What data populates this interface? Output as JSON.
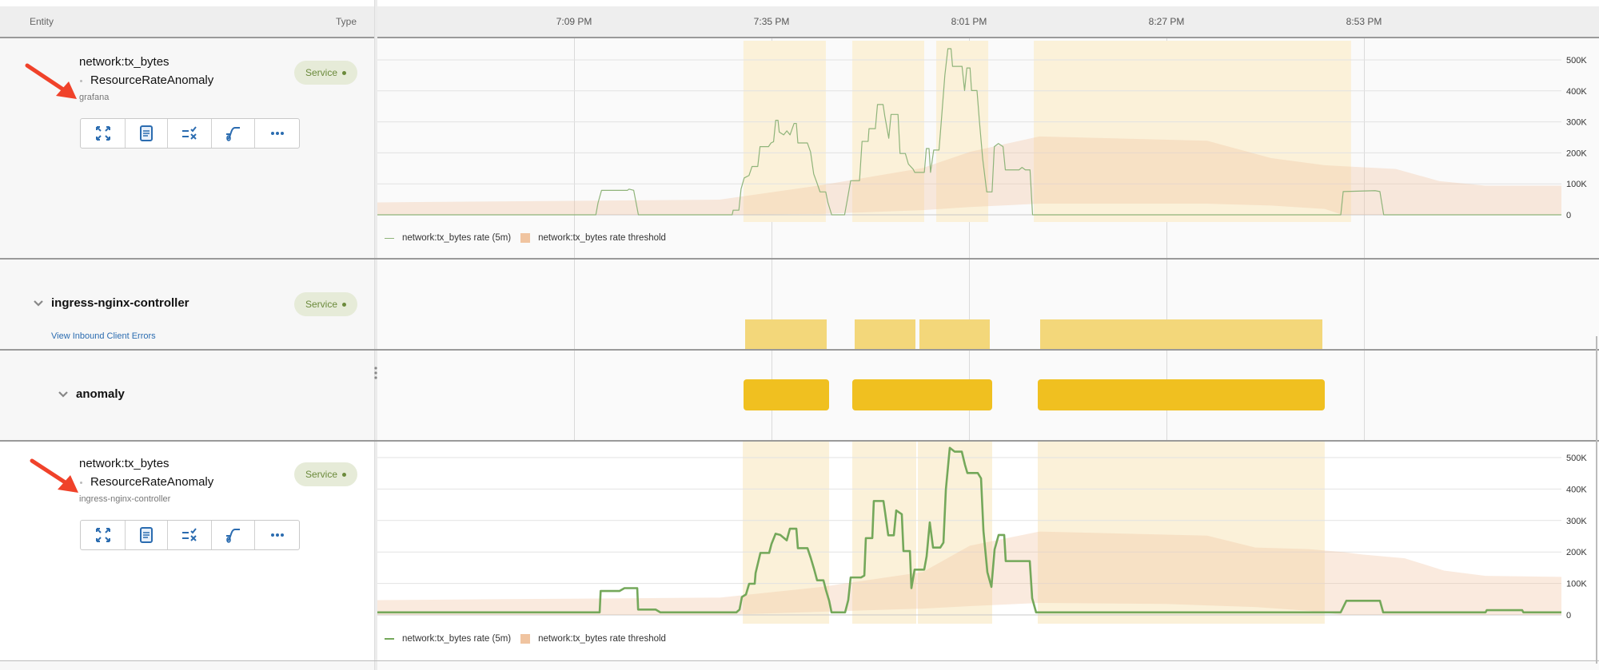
{
  "header": {
    "entity_label": "Entity",
    "type_label": "Type"
  },
  "time_axis": {
    "range": [
      "18:43:06",
      "21:19:00"
    ],
    "ticks": [
      {
        "time": "19:09:00",
        "label": "7:09 PM"
      },
      {
        "time": "19:35:00",
        "label": "7:35 PM"
      },
      {
        "time": "20:01:00",
        "label": "8:01 PM"
      },
      {
        "time": "20:27:00",
        "label": "8:27 PM"
      },
      {
        "time": "20:53:00",
        "label": "8:53 PM"
      }
    ]
  },
  "rows": [
    {
      "metric": "network:tx_bytes",
      "check": "ResourceRateAnomaly",
      "source": "grafana",
      "type_badge": "Service"
    },
    {
      "group": "ingress-nginx-controller",
      "link": "View Inbound Client Errors",
      "type_badge": "Service"
    },
    {
      "group": "anomaly"
    },
    {
      "metric": "network:tx_bytes",
      "check": "ResourceRateAnomaly",
      "source": "ingress-nginx-controller",
      "type_badge": "Service"
    }
  ],
  "action_icons": [
    "expand-icon",
    "document-icon",
    "list-check-icon",
    "curve-icon",
    "more-icon"
  ],
  "colors": {
    "series": "#74a85a",
    "threshold": "#f0c4a0",
    "anomaly_band": "#fbf1d9",
    "ingress_bar": "#f3d77a",
    "anomaly_bar": "#f0c020",
    "badge_text": "#6b8a3b",
    "link": "#2b6cb0",
    "annotation_arrow": "#f0422a"
  },
  "ingress_bars": [
    [
      "19:31:32",
      "19:42:16"
    ],
    [
      "19:45:57",
      "19:53:57"
    ],
    [
      "19:54:28",
      "20:03:44"
    ],
    [
      "20:10:22",
      "20:47:32"
    ]
  ],
  "anomaly_bars": [
    [
      "19:31:19",
      "19:42:35"
    ],
    [
      "19:45:38",
      "20:04:03"
    ],
    [
      "20:10:03",
      "20:47:50"
    ]
  ],
  "chart_data": [
    {
      "type": "line",
      "title": "",
      "ylim": [
        0,
        500000
      ],
      "yticks": [
        "0",
        "100K",
        "200K",
        "300K",
        "400K",
        "500K"
      ],
      "grid": true,
      "legend": "bottom-left",
      "legend_entries": [
        "network:tx_bytes rate (5m)",
        "network:tx_bytes rate threshold"
      ],
      "anomaly_bands": [
        [
          "19:31:18",
          "19:42:09"
        ],
        [
          "19:45:38",
          "19:55:06"
        ],
        [
          "19:56:41",
          "20:03:32"
        ],
        [
          "20:09:32",
          "20:51:18"
        ]
      ],
      "threshold": [
        [
          "18:43:06",
          0,
          40000
        ],
        [
          "19:28:10",
          0,
          49000
        ],
        [
          "19:41:38",
          3000,
          96000
        ],
        [
          "19:54:54",
          15000,
          151000
        ],
        [
          "20:01:06",
          25000,
          203000
        ],
        [
          "20:10:16",
          36000,
          253000
        ],
        [
          "20:32:22",
          36000,
          239000
        ],
        [
          "20:40:47",
          30000,
          183000
        ],
        [
          "20:47:50",
          19000,
          160000
        ],
        [
          "20:50:10",
          0,
          157000
        ],
        [
          "20:57:12",
          0,
          148000
        ],
        [
          "21:02:54",
          0,
          109000
        ],
        [
          "21:09:00",
          0,
          94000
        ],
        [
          "21:19:00",
          0,
          94000
        ]
      ],
      "series": [
        {
          "name": "network:tx_bytes rate (5m)",
          "points": [
            [
              "18:43:06",
              0
            ],
            [
              "19:11:52",
              0
            ],
            [
              "19:12:09",
              38000
            ],
            [
              "19:12:37",
              79000
            ],
            [
              "19:16:01",
              79000
            ],
            [
              "19:16:14",
              83000
            ],
            [
              "19:16:51",
              79000
            ],
            [
              "19:17:08",
              43000
            ],
            [
              "19:17:28",
              0
            ],
            [
              "19:29:49",
              0
            ],
            [
              "19:29:57",
              15000
            ],
            [
              "19:30:42",
              15000
            ],
            [
              "19:30:59",
              83000
            ],
            [
              "19:31:24",
              119000
            ],
            [
              "19:32:02",
              127000
            ],
            [
              "19:32:26",
              156000
            ],
            [
              "19:33:11",
              156000
            ],
            [
              "19:33:29",
              220000
            ],
            [
              "19:34:36",
              220000
            ],
            [
              "19:34:56",
              232000
            ],
            [
              "19:35:16",
              236000
            ],
            [
              "19:35:33",
              305000
            ],
            [
              "19:35:51",
              305000
            ],
            [
              "19:36:01",
              267000
            ],
            [
              "19:36:36",
              258000
            ],
            [
              "19:37:01",
              271000
            ],
            [
              "19:37:26",
              258000
            ],
            [
              "19:37:58",
              295000
            ],
            [
              "19:38:16",
              295000
            ],
            [
              "19:38:28",
              232000
            ],
            [
              "19:39:43",
              232000
            ],
            [
              "19:40:08",
              203000
            ],
            [
              "19:40:33",
              132000
            ],
            [
              "19:40:58",
              104000
            ],
            [
              "19:41:23",
              74000
            ],
            [
              "19:42:08",
              74000
            ],
            [
              "19:42:25",
              40000
            ],
            [
              "19:42:55",
              0
            ],
            [
              "19:44:37",
              0
            ],
            [
              "19:44:55",
              40000
            ],
            [
              "19:45:25",
              110000
            ],
            [
              "19:46:35",
              110000
            ],
            [
              "19:46:55",
              237000
            ],
            [
              "19:47:43",
              237000
            ],
            [
              "19:47:50",
              278000
            ],
            [
              "19:48:40",
              278000
            ],
            [
              "19:48:57",
              356000
            ],
            [
              "19:49:41",
              356000
            ],
            [
              "19:49:55",
              318000
            ],
            [
              "19:50:26",
              247000
            ],
            [
              "19:50:44",
              324000
            ],
            [
              "19:51:39",
              324000
            ],
            [
              "19:51:55",
              198000
            ],
            [
              "19:52:37",
              198000
            ],
            [
              "19:53:01",
              164000
            ],
            [
              "19:53:39",
              147000
            ],
            [
              "19:53:51",
              137000
            ],
            [
              "19:55:07",
              137000
            ],
            [
              "19:55:23",
              214000
            ],
            [
              "19:55:44",
              214000
            ],
            [
              "19:55:56",
              137000
            ],
            [
              "19:56:21",
              209000
            ],
            [
              "19:57:03",
              209000
            ],
            [
              "19:57:23",
              312000
            ],
            [
              "19:57:49",
              450000
            ],
            [
              "19:58:13",
              536000
            ],
            [
              "19:58:38",
              536000
            ],
            [
              "19:58:50",
              479000
            ],
            [
              "20:00:05",
              479000
            ],
            [
              "20:00:25",
              401000
            ],
            [
              "20:00:43",
              474000
            ],
            [
              "20:01:08",
              474000
            ],
            [
              "20:01:20",
              401000
            ],
            [
              "20:02:03",
              401000
            ],
            [
              "20:02:23",
              298000
            ],
            [
              "20:02:48",
              181000
            ],
            [
              "20:03:20",
              74000
            ],
            [
              "20:04:02",
              74000
            ],
            [
              "20:04:20",
              220000
            ],
            [
              "20:04:52",
              230000
            ],
            [
              "20:05:29",
              220000
            ],
            [
              "20:05:47",
              145000
            ],
            [
              "20:07:35",
              145000
            ],
            [
              "20:07:59",
              153000
            ],
            [
              "20:08:25",
              145000
            ],
            [
              "20:09:02",
              145000
            ],
            [
              "20:09:22",
              0
            ],
            [
              "20:49:57",
              0
            ],
            [
              "20:50:16",
              75000
            ],
            [
              "20:54:28",
              78000
            ],
            [
              "20:55:06",
              75000
            ],
            [
              "20:55:36",
              0
            ],
            [
              "21:19:00",
              0
            ]
          ]
        }
      ]
    },
    {
      "type": "line",
      "title": "",
      "ylim": [
        0,
        500000
      ],
      "yticks": [
        "0",
        "100K",
        "200K",
        "300K",
        "400K",
        "500K"
      ],
      "grid": true,
      "legend": "bottom-left",
      "legend_entries": [
        "network:tx_bytes rate (5m)",
        "network:tx_bytes rate threshold"
      ],
      "anomaly_bands": [
        [
          "19:31:13",
          "19:42:35"
        ],
        [
          "19:45:38",
          "19:54:03"
        ],
        [
          "19:54:16",
          "20:04:03"
        ],
        [
          "20:10:03",
          "20:47:50"
        ]
      ],
      "threshold": [
        [
          "18:43:06",
          0,
          47000
        ],
        [
          "19:28:10",
          0,
          55000
        ],
        [
          "19:41:38",
          10000,
          89000
        ],
        [
          "19:54:54",
          20000,
          136000
        ],
        [
          "20:01:06",
          28000,
          220000
        ],
        [
          "20:10:16",
          38000,
          265000
        ],
        [
          "20:26:54",
          35000,
          255000
        ],
        [
          "20:32:22",
          30000,
          252000
        ],
        [
          "20:38:41",
          25000,
          214000
        ],
        [
          "20:45:44",
          13000,
          209000
        ],
        [
          "20:50:10",
          0,
          200000
        ],
        [
          "20:52:47",
          0,
          192000
        ],
        [
          "20:58:22",
          0,
          180000
        ],
        [
          "21:03:32",
          0,
          141000
        ],
        [
          "21:09:00",
          0,
          124000
        ],
        [
          "21:19:00",
          0,
          121000
        ]
      ],
      "series": [
        {
          "name": "network:tx_bytes rate (5m)",
          "points": [
            [
              "18:43:06",
              8000
            ],
            [
              "19:12:22",
              8000
            ],
            [
              "19:12:30",
              76000
            ],
            [
              "19:15:00",
              76000
            ],
            [
              "19:15:38",
              85000
            ],
            [
              "19:17:19",
              85000
            ],
            [
              "19:17:26",
              17000
            ],
            [
              "19:19:44",
              17000
            ],
            [
              "19:20:22",
              8000
            ],
            [
              "19:30:22",
              8000
            ],
            [
              "19:30:47",
              17000
            ],
            [
              "19:31:06",
              57000
            ],
            [
              "19:31:38",
              65000
            ],
            [
              "19:32:03",
              99000
            ],
            [
              "19:32:47",
              99000
            ],
            [
              "19:32:54",
              133000
            ],
            [
              "19:33:32",
              197000
            ],
            [
              "19:34:41",
              197000
            ],
            [
              "19:35:00",
              226000
            ],
            [
              "19:35:32",
              258000
            ],
            [
              "19:36:09",
              254000
            ],
            [
              "19:37:00",
              237000
            ],
            [
              "19:37:25",
              274000
            ],
            [
              "19:38:16",
              274000
            ],
            [
              "19:38:28",
              212000
            ],
            [
              "19:39:44",
              212000
            ],
            [
              "19:40:09",
              182000
            ],
            [
              "19:40:35",
              147000
            ],
            [
              "19:41:00",
              110000
            ],
            [
              "19:41:50",
              110000
            ],
            [
              "19:42:09",
              80000
            ],
            [
              "19:42:35",
              45000
            ],
            [
              "19:42:54",
              8000
            ],
            [
              "19:44:41",
              8000
            ],
            [
              "19:45:06",
              47000
            ],
            [
              "19:45:25",
              119000
            ],
            [
              "19:46:47",
              119000
            ],
            [
              "19:47:13",
              125000
            ],
            [
              "19:47:25",
              244000
            ],
            [
              "19:48:16",
              244000
            ],
            [
              "19:48:28",
              362000
            ],
            [
              "19:49:44",
              362000
            ],
            [
              "19:49:57",
              326000
            ],
            [
              "19:50:22",
              253000
            ],
            [
              "19:51:06",
              253000
            ],
            [
              "19:51:25",
              332000
            ],
            [
              "19:52:09",
              320000
            ],
            [
              "19:52:22",
              203000
            ],
            [
              "19:53:13",
              203000
            ],
            [
              "19:53:25",
              85000
            ],
            [
              "19:53:50",
              144000
            ],
            [
              "19:55:06",
              144000
            ],
            [
              "19:55:25",
              186000
            ],
            [
              "19:55:50",
              294000
            ],
            [
              "19:56:16",
              214000
            ],
            [
              "19:57:13",
              214000
            ],
            [
              "19:57:38",
              230000
            ],
            [
              "19:57:57",
              398000
            ],
            [
              "19:58:28",
              531000
            ],
            [
              "19:59:06",
              519000
            ],
            [
              "20:00:03",
              519000
            ],
            [
              "20:00:28",
              477000
            ],
            [
              "20:00:47",
              451000
            ],
            [
              "20:02:09",
              451000
            ],
            [
              "20:02:35",
              434000
            ],
            [
              "20:02:54",
              267000
            ],
            [
              "20:03:25",
              136000
            ],
            [
              "20:03:57",
              89000
            ],
            [
              "20:04:22",
              208000
            ],
            [
              "20:04:54",
              254000
            ],
            [
              "20:05:38",
              254000
            ],
            [
              "20:05:50",
              171000
            ],
            [
              "20:09:00",
              171000
            ],
            [
              "20:09:19",
              53000
            ],
            [
              "20:09:50",
              8000
            ],
            [
              "20:49:56",
              8000
            ],
            [
              "20:50:41",
              45000
            ],
            [
              "20:55:06",
              45000
            ],
            [
              "20:55:32",
              8000
            ],
            [
              "21:09:00",
              8000
            ],
            [
              "21:09:10",
              15000
            ],
            [
              "21:13:50",
              15000
            ],
            [
              "21:14:00",
              8000
            ],
            [
              "21:19:00",
              8000
            ]
          ]
        }
      ]
    }
  ]
}
